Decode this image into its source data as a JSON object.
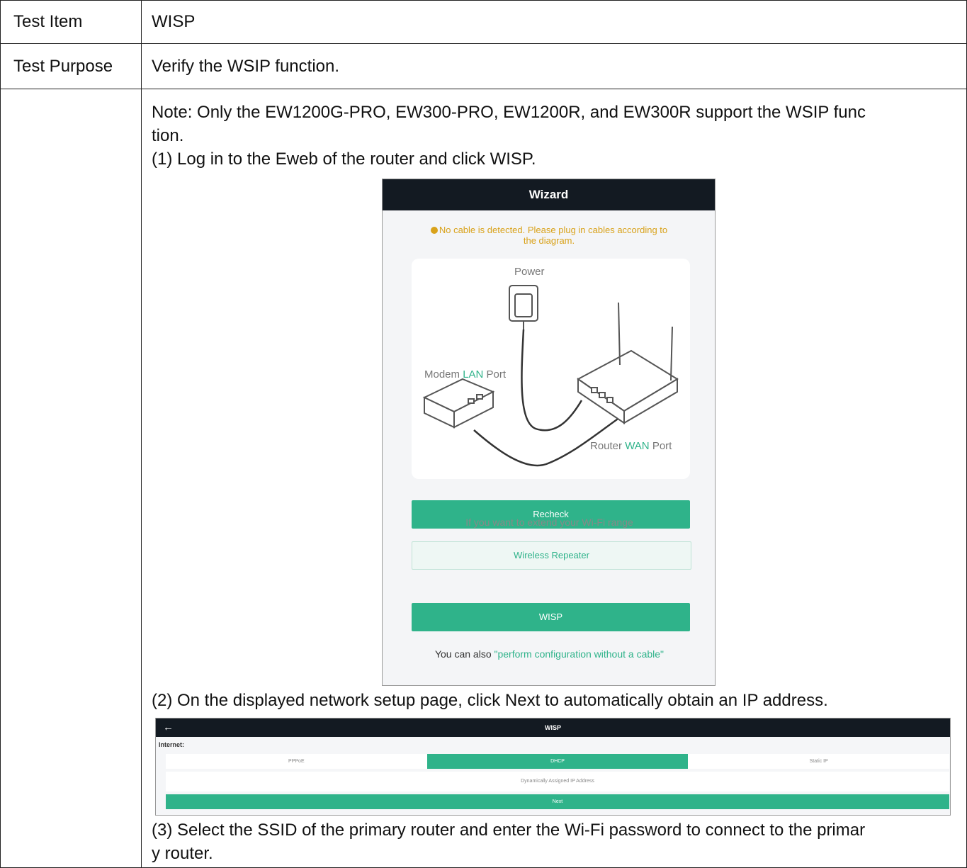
{
  "table": {
    "rows": [
      {
        "label": "Test Item",
        "value": "WISP"
      },
      {
        "label": "Test Purpose",
        "value": "Verify the WSIP function."
      }
    ],
    "steps": {
      "note_line1": "Note: Only the EW1200G-PRO, EW300-PRO, EW1200R, and EW300R support the WSIP func",
      "note_line2": "tion.",
      "step1": "(1) Log in to the Eweb of the router and click WISP.",
      "step2": "(2) On the displayed network setup page, click Next to automatically obtain an IP address.",
      "step3_line1": "(3) Select the SSID of the primary router and enter the Wi-Fi password to connect to the primar",
      "step3_line2": "y router."
    }
  },
  "wizard": {
    "title": "Wizard",
    "warning_line1": "No cable is detected. Please plug in cables according to",
    "warning_line2": "the diagram.",
    "diagram": {
      "power_label": "Power",
      "modem_prefix": "Modem ",
      "modem_highlight": "LAN",
      "modem_suffix": " Port",
      "router_prefix": "Router ",
      "router_highlight": "WAN",
      "router_suffix": " Port"
    },
    "recheck_button": "Recheck",
    "extend_text": "If you want to extend your Wi-Fi range",
    "wireless_repeater_button": "Wireless Repeater",
    "wisp_button": "WISP",
    "footer_prefix": "You can also ",
    "footer_link": "\"perform configuration without a cable\"",
    "colors": {
      "accent": "#2fb38a",
      "header": "#131a22",
      "warning": "#d9a21a"
    }
  },
  "wisp_page": {
    "back_icon": "←",
    "title": "WISP",
    "internet_label": "Internet:",
    "tabs": [
      {
        "label": "PPPoE",
        "active": false
      },
      {
        "label": "DHCP",
        "active": true
      },
      {
        "label": "Static IP",
        "active": false
      }
    ],
    "description": "Dynamically Assigned IP Address",
    "next_button": "Next"
  }
}
